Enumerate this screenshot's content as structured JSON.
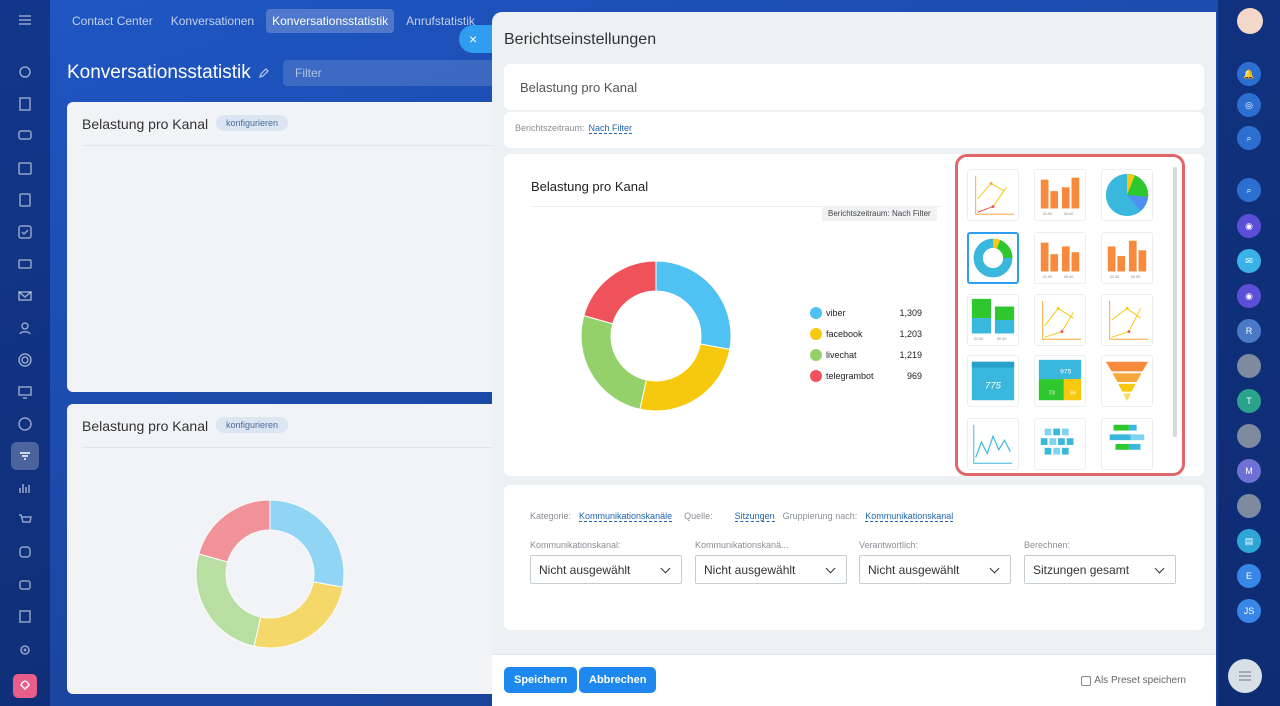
{
  "topnav": {
    "items": [
      "Contact Center",
      "Konversationen",
      "Konversationsstatistik",
      "Anrufstatistik"
    ],
    "active_index": 2
  },
  "page": {
    "title": "Konversationsstatistik",
    "filter_placeholder": "Filter"
  },
  "cards": [
    {
      "title": "Belastung pro Kanal",
      "configure": "konfigurieren"
    },
    {
      "title": "Belastung pro Kanal",
      "configure": "konfigurieren"
    }
  ],
  "modal": {
    "close": "×",
    "title": "Berichtseinstellungen",
    "report_name": "Belastung pro Kanal",
    "period_label": "Berichtszeitraum:",
    "period_value": "Nach Filter",
    "preview_title": "Belastung pro Kanal",
    "preview_badge": "Berichtszeitraum: Nach Filter",
    "thumbs": {
      "bar_label_1": "01.00",
      "bar_label_2": "00.00",
      "number_775": "775",
      "number_975": "975",
      "number_73": "73",
      "number_96": "96"
    },
    "settings": {
      "category_label": "Kategorie:",
      "category_value": "Kommunikationskanäle",
      "source_label": "Quelle:",
      "source_value": "Sitzungen",
      "group_label": "Gruppierung nach:",
      "group_value": "Kommunikationskanal",
      "selects": [
        {
          "label": "Kommunikationskanal:",
          "value": "Nicht ausgewählt"
        },
        {
          "label": "Kommunikationskanä...",
          "value": "Nicht ausgewählt"
        },
        {
          "label": "Verantwortlich:",
          "value": "Nicht ausgewählt"
        },
        {
          "label": "Berechnen:",
          "value": "Sitzungen gesamt"
        }
      ]
    },
    "footer": {
      "save": "Speichern",
      "cancel": "Abbrechen",
      "preset": "Als Preset speichern"
    }
  },
  "right_sidebar": {
    "avatars": [
      "R",
      "T",
      "M",
      "E",
      "JS"
    ]
  },
  "colors": {
    "viber": "#4fc1f2",
    "facebook": "#f6c80e",
    "livechat": "#94d16a",
    "telegrambot": "#f0525b"
  },
  "chart_data": {
    "type": "pie",
    "categories": [
      "viber",
      "facebook",
      "livechat",
      "telegrambot"
    ],
    "values": [
      1309,
      1203,
      1219,
      969
    ],
    "value_labels": [
      "1,309",
      "1,203",
      "1,219",
      "969"
    ],
    "donut": true
  }
}
